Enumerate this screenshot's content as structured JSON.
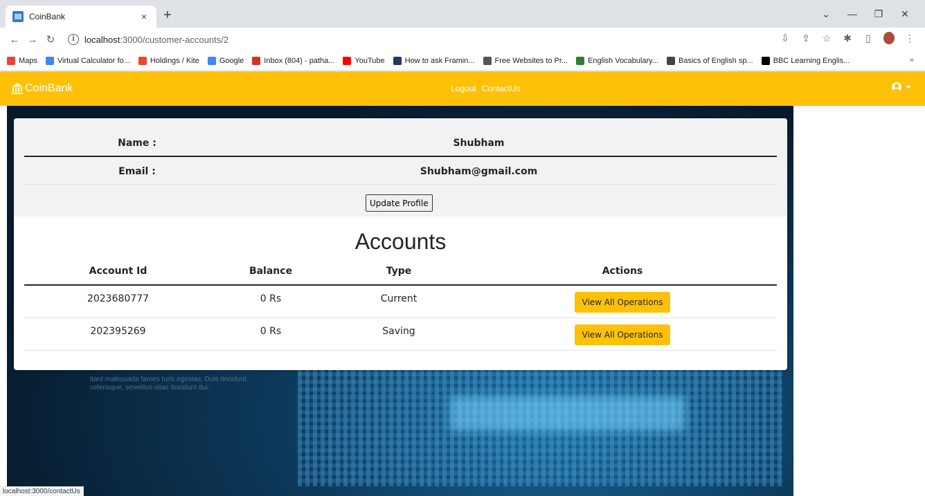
{
  "browser": {
    "tab_title": "CoinBank",
    "tab_close": "×",
    "new_tab": "+",
    "url_host": "localhost",
    "url_path": ":3000/customer-accounts/2",
    "bookmarks": [
      {
        "label": "Maps",
        "icon": "maps-icon",
        "color": "#ea4335"
      },
      {
        "label": "Virtual Calculator fo...",
        "icon": "calculator-icon",
        "color": "#4285f4"
      },
      {
        "label": "Holdings / Kite",
        "icon": "kite-icon",
        "color": "#e84a27"
      },
      {
        "label": "Google",
        "icon": "google-icon",
        "color": "#4285f4"
      },
      {
        "label": "Inbox (804) - patha...",
        "icon": "gmail-icon",
        "color": "#d93025"
      },
      {
        "label": "YouTube",
        "icon": "youtube-icon",
        "color": "#ff0000"
      },
      {
        "label": "How to ask Framin...",
        "icon": "framing-icon",
        "color": "#1e3a5f"
      },
      {
        "label": "Free Websites to Pr...",
        "icon": "web-icon",
        "color": "#555555"
      },
      {
        "label": "English Vocabulary...",
        "icon": "vocab-icon",
        "color": "#2e7d32"
      },
      {
        "label": "Basics of English sp...",
        "icon": "globe-icon",
        "color": "#444444"
      },
      {
        "label": "BBC Learning Englis...",
        "icon": "bbc-icon",
        "color": "#000000"
      }
    ],
    "bookmarks_more": "»",
    "status_url": "localhost:3000/contactUs"
  },
  "app": {
    "brand": "CoinBank",
    "accent": "#ffc107",
    "nav_links": [
      "Logout",
      "ContactUs"
    ]
  },
  "profile": {
    "name_label": "Name :",
    "name_value": "Shubham",
    "email_label": "Email :",
    "email_value": "Shubham@gmail.com",
    "update_button": "Update Profile"
  },
  "accounts": {
    "title": "Accounts",
    "headers": [
      "Account Id",
      "Balance",
      "Type",
      "Actions"
    ],
    "rows": [
      {
        "id": "2023680777",
        "balance": "0 Rs",
        "type": "Current",
        "action": "View All Operations"
      },
      {
        "id": "202395269",
        "balance": "0 Rs",
        "type": "Saving",
        "action": "View All Operations"
      }
    ]
  },
  "background_text": "itant malesuada fames turis egestas. Duis tincidunt celerisque, sevelitus vitae tincidunt dui."
}
